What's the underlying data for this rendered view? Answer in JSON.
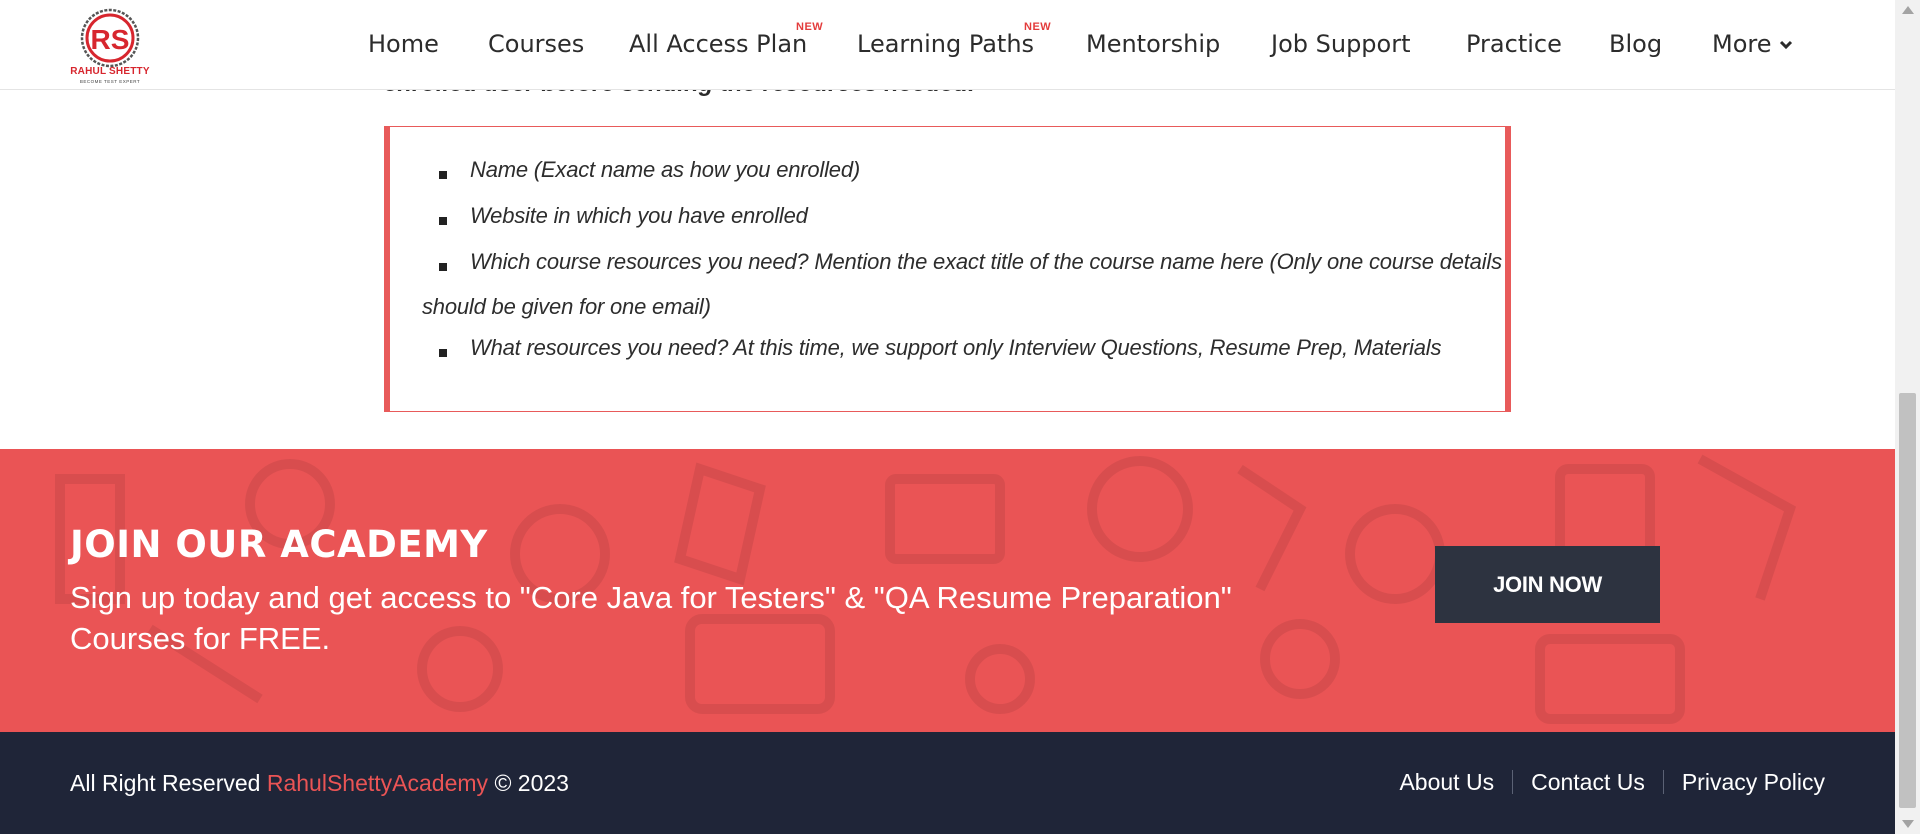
{
  "brand": {
    "logo_monogram": "RS",
    "logo_name": "RAHUL SHETTY",
    "logo_tagline": "BECOME TEST EXPERT",
    "accent_color": "#ea5455",
    "dark_color": "#2d3340"
  },
  "nav": {
    "items": [
      {
        "label": "Home"
      },
      {
        "label": "Courses"
      },
      {
        "label": "All Access Plan",
        "badge": "NEW"
      },
      {
        "label": "Learning Paths",
        "badge": "NEW"
      },
      {
        "label": "Mentorship"
      },
      {
        "label": "Job Support"
      },
      {
        "label": "Practice"
      },
      {
        "label": "Blog"
      },
      {
        "label": "More"
      }
    ],
    "more_icon": "chevron-down-icon"
  },
  "content": {
    "cut_off_text": "enrolled user before sending the resources needed.",
    "requirements": [
      "Name (Exact name as how you enrolled)",
      "Website in which you have enrolled",
      "Which course resources you need? Mention the exact title of the course name here (Only one course details",
      "should be given for one email)",
      "What resources you need? At this time, we support only Interview Questions, Resume Prep, Materials"
    ]
  },
  "join": {
    "title": "JOIN OUR ACADEMY",
    "description": "Sign up today and get access to \"Core Java for Testers\" & \"QA Resume Preparation\" Courses for FREE.",
    "button_label": "JOIN NOW"
  },
  "footer": {
    "copyright_prefix": "All Right Reserved",
    "copyright_brand": "RahulShettyAcademy",
    "copyright_suffix": "© 2023",
    "links": [
      "About Us",
      "Contact Us",
      "Privacy Policy"
    ]
  }
}
